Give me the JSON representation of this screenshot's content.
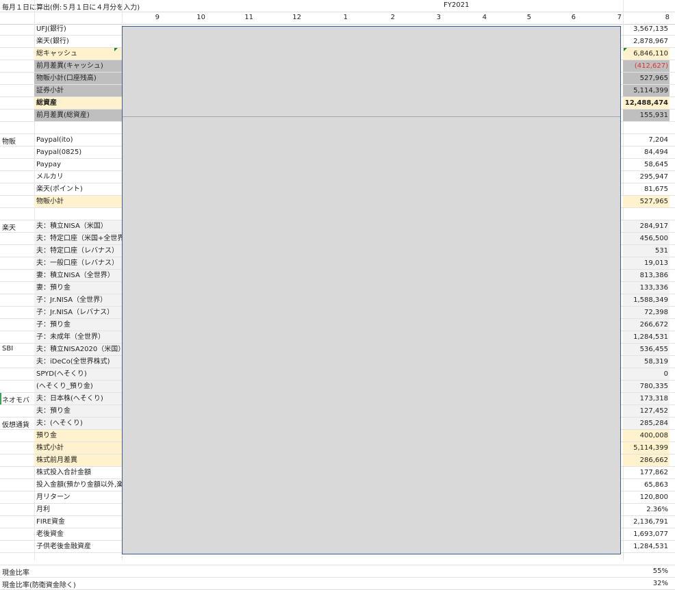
{
  "header": {
    "note": "毎月１日に算出(例:５月１日に４月分を入力)",
    "fiscal_year": "FY2021",
    "columns": [
      "9",
      "10",
      "11",
      "12",
      "1",
      "2",
      "3",
      "4",
      "5",
      "6",
      "7",
      "8"
    ]
  },
  "rows": [
    {
      "category": "",
      "label": "UFJ(銀行)",
      "value": "3,567,135",
      "style": ""
    },
    {
      "category": "",
      "label": "楽天(銀行)",
      "value": "2,878,967",
      "style": ""
    },
    {
      "category": "",
      "label": "総キャッシュ",
      "value": "6,846,110",
      "style": "yellow"
    },
    {
      "category": "",
      "label": "前月差異(キャッシュ)",
      "value": "(412,627)",
      "style": "gray",
      "negative": true
    },
    {
      "category": "",
      "label": "物販小計(口座残高)",
      "value": "527,965",
      "style": "gray"
    },
    {
      "category": "",
      "label": "証券小計",
      "value": "5,114,399",
      "style": "gray"
    },
    {
      "category": "",
      "label": "総資産",
      "value": "12,488,474",
      "style": "yellow",
      "bold": true
    },
    {
      "category": "",
      "label": "前月差異(総資産)",
      "value": "155,931",
      "style": "gray"
    },
    {
      "category": "",
      "label": "",
      "value": "",
      "style": ""
    },
    {
      "category": "物販",
      "label": "Paypal(ito)",
      "value": "7,204",
      "style": ""
    },
    {
      "category": "",
      "label": "Paypal(0825)",
      "value": "84,494",
      "style": ""
    },
    {
      "category": "",
      "label": "Paypay",
      "value": "58,645",
      "style": ""
    },
    {
      "category": "",
      "label": "メルカリ",
      "value": "295,947",
      "style": ""
    },
    {
      "category": "",
      "label": "楽天(ポイント)",
      "value": "81,675",
      "style": ""
    },
    {
      "category": "",
      "label": "物販小計",
      "value": "527,965",
      "style": "yellow"
    },
    {
      "category": "",
      "label": "",
      "value": "",
      "style": ""
    },
    {
      "category": "楽天",
      "label": "夫：積立NISA（米国）",
      "value": "284,917",
      "style": "alt"
    },
    {
      "category": "",
      "label": "夫：特定口座（米国+全世界",
      "value": "456,500",
      "style": "alt"
    },
    {
      "category": "",
      "label": "夫：特定口座（レバナス）",
      "value": "531",
      "style": "alt"
    },
    {
      "category": "",
      "label": "夫：一般口座（レバナス）",
      "value": "19,013",
      "style": "alt"
    },
    {
      "category": "",
      "label": "妻：積立NISA（全世界）",
      "value": "813,386",
      "style": "alt"
    },
    {
      "category": "",
      "label": "妻：預り金",
      "value": "133,336",
      "style": "alt"
    },
    {
      "category": "",
      "label": "子：Jr.NISA（全世界）",
      "value": "1,588,349",
      "style": "alt"
    },
    {
      "category": "",
      "label": "子：Jr.NISA（レバナス）",
      "value": "72,398",
      "style": "alt"
    },
    {
      "category": "",
      "label": "子：預り金",
      "value": "266,672",
      "style": "alt"
    },
    {
      "category": "",
      "label": "子：未成年（全世界）",
      "value": "1,284,531",
      "style": "alt"
    },
    {
      "category": "SBI",
      "label": "夫：積立NISA2020（米国）",
      "value": "536,455",
      "style": "alt"
    },
    {
      "category": "",
      "label": "夫：iDeCo(全世界株式)",
      "value": "58,319",
      "style": "alt"
    },
    {
      "category": "",
      "label": "SPYD(へそくり)",
      "value": "0",
      "style": "alt"
    },
    {
      "category": "",
      "label": "(へそくり_預り金)",
      "value": "780,335",
      "style": "alt"
    },
    {
      "category": "ネオモバ",
      "label": "夫：日本株(へそくり)",
      "value": "173,318",
      "style": "alt",
      "mark": true
    },
    {
      "category": "",
      "label": "夫：預り金",
      "value": "127,452",
      "style": "alt"
    },
    {
      "category": "仮想通貨",
      "label": "夫：(へそくり)",
      "value": "285,284",
      "style": "alt"
    },
    {
      "category": "",
      "label": "預り金",
      "value": "400,008",
      "style": "yellow"
    },
    {
      "category": "",
      "label": "株式小計",
      "value": "5,114,399",
      "style": "yellow"
    },
    {
      "category": "",
      "label": "株式前月差異",
      "value": "286,662",
      "style": "yellow"
    },
    {
      "category": "",
      "label": "株式投入合計金額",
      "value": "177,862",
      "style": ""
    },
    {
      "category": "",
      "label": "投入金額(預かり金額以外,楽",
      "value": "65,863",
      "style": ""
    },
    {
      "category": "",
      "label": "月リターン",
      "value": "120,800",
      "style": ""
    },
    {
      "category": "",
      "label": "月利",
      "value": "2.36%",
      "style": ""
    },
    {
      "category": "",
      "label": "FIRE資金",
      "value": "2,136,791",
      "style": ""
    },
    {
      "category": "",
      "label": "老後資金",
      "value": "1,693,077",
      "style": ""
    },
    {
      "category": "",
      "label": "子供老後金融資産",
      "value": "1,284,531",
      "style": ""
    },
    {
      "category": "",
      "label": "",
      "value": "",
      "style": ""
    },
    {
      "category": "現金比率",
      "label": "",
      "value": "55%",
      "style": ""
    },
    {
      "category": "現金比率(防衛資金除く)",
      "label": "",
      "value": "32%",
      "style": ""
    }
  ]
}
